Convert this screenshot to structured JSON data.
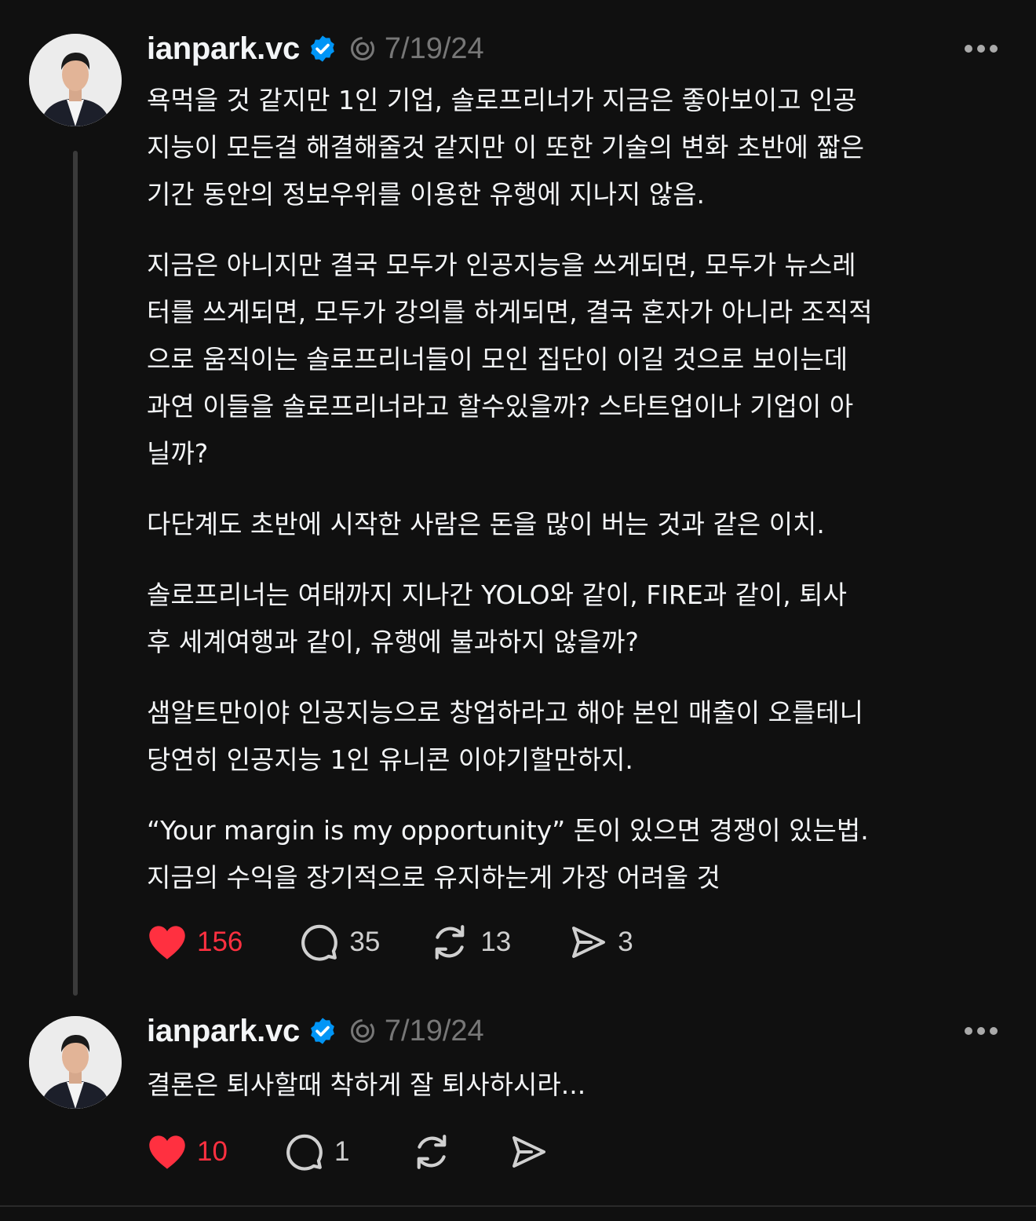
{
  "colors": {
    "background": "#101010",
    "text": "#f3f5f7",
    "muted": "#777777",
    "like": "#ff3040",
    "verified": "#0095f6"
  },
  "posts": [
    {
      "username": "ianpark.vc",
      "date": "7/19/24",
      "paragraphs": [
        "욕먹을 것 같지만 1인 기업, 솔로프리너가 지금은 좋아보이고 인공\n지능이 모든걸 해결해줄것 같지만 이 또한 기술의 변화 초반에 짧은\n기간 동안의 정보우위를 이용한 유행에 지나지 않음.",
        "지금은 아니지만 결국 모두가 인공지능을 쓰게되면, 모두가 뉴스레\n터를 쓰게되면, 모두가 강의를 하게되면, 결국 혼자가 아니라 조직적\n으로 움직이는 솔로프리너들이 모인 집단이 이길 것으로 보이는데\n과연 이들을 솔로프리너라고 할수있을까? 스타트업이나 기업이 아\n닐까?",
        "다단계도 초반에 시작한 사람은 돈을 많이 버는 것과 같은 이치.",
        "솔로프리너는 여태까지 지나간 YOLO와 같이, FIRE과 같이, 퇴사\n후 세계여행과 같이, 유행에 불과하지 않을까?",
        "샘알트만이야 인공지능으로 창업하라고 해야 본인 매출이 오를테니\n당연히 인공지능 1인 유니콘 이야기할만하지.",
        "“Your margin is my opportunity” 돈이 있으면 경쟁이 있는법.\n지금의 수익을 장기적으로 유지하는게 가장 어려울 것"
      ],
      "likes": "156",
      "comments": "35",
      "reposts": "13",
      "shares": "3"
    },
    {
      "username": "ianpark.vc",
      "date": "7/19/24",
      "paragraphs": [
        "결론은 퇴사할때 착하게 잘 퇴사하시라..."
      ],
      "likes": "10",
      "comments": "1"
    }
  ]
}
